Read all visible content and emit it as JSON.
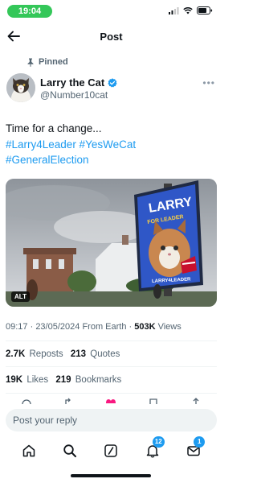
{
  "status_bar": {
    "time": "19:04"
  },
  "header": {
    "title": "Post"
  },
  "pinned_label": "Pinned",
  "author": {
    "name": "Larry the Cat",
    "handle": "@Number10cat"
  },
  "tweet": {
    "text_line": "Time for a change...",
    "hashtags_line1": "#Larry4Leader #YesWeCat",
    "hashtags_line2": "#GeneralElection"
  },
  "media": {
    "alt_label": "ALT",
    "billboard_title": "LARRY",
    "billboard_subtitle": "FOR LEADER",
    "billboard_footer": "LARRY4LEADER"
  },
  "meta": {
    "time": "09:17",
    "date": "23/05/2024",
    "source": "From Earth",
    "views_count": "503K",
    "views_label": "Views"
  },
  "stats": {
    "reposts_count": "2.7K",
    "reposts_label": "Reposts",
    "quotes_count": "213",
    "quotes_label": "Quotes",
    "likes_count": "19K",
    "likes_label": "Likes",
    "bookmarks_count": "219",
    "bookmarks_label": "Bookmarks"
  },
  "reply": {
    "placeholder": "Post your reply"
  },
  "nav": {
    "notifications_badge": "12",
    "messages_badge": "1"
  },
  "colors": {
    "accent": "#1d9bf0",
    "text": "#0f1419",
    "muted": "#536471",
    "like": "#f91880",
    "status_green": "#34c759"
  }
}
